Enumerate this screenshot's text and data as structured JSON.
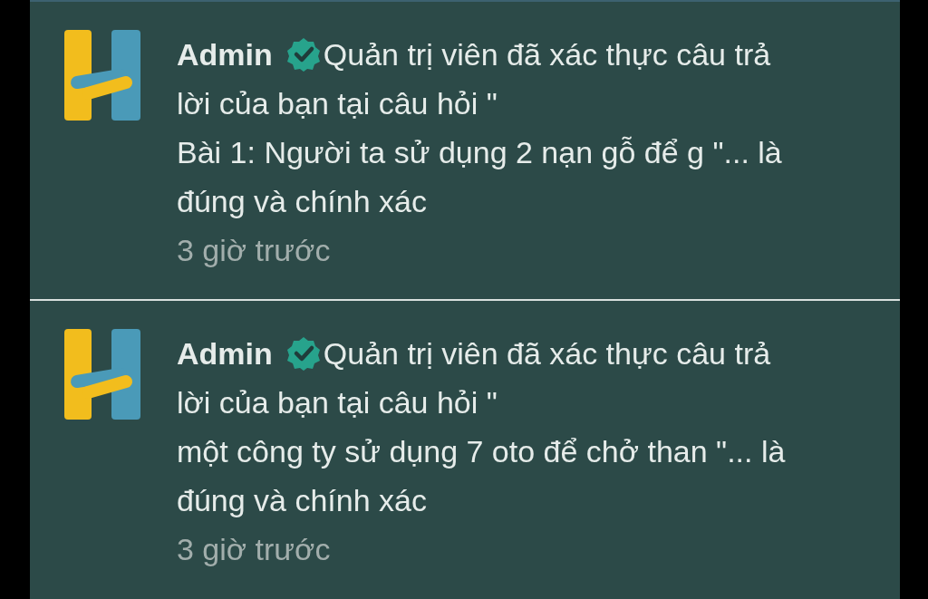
{
  "notifications": [
    {
      "author": "Admin",
      "verified": true,
      "message_start": "Quản trị viên đã xác thực câu trả",
      "message_rest": "lời của bạn tại câu hỏi \"",
      "question": "Bài 1: Người ta sử dụng 2 nạn gỗ để g \"... là đúng và chính xác",
      "time": "3 giờ trước"
    },
    {
      "author": "Admin",
      "verified": true,
      "message_start": "Quản trị viên đã xác thực câu trả",
      "message_rest": "lời của bạn tại câu hỏi \"",
      "question": "một công ty sử dụng 7 oto để chở than \"... là đúng và chính xác",
      "time": "3 giờ trước"
    }
  ]
}
